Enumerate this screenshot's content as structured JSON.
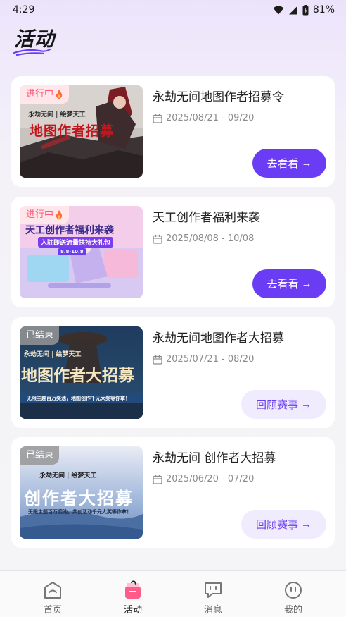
{
  "status_bar": {
    "time": "4:29",
    "battery": "81%"
  },
  "header": {
    "title": "活动"
  },
  "colors": {
    "accent": "#6a3cf3",
    "active_tag": "#ff5674",
    "ended_tag": "#969696"
  },
  "activities": [
    {
      "status": "进行中",
      "title": "永劫无间地图作者招募令",
      "date_range": "2025/08/21 - 09/20",
      "button_label": "去看看",
      "banner": {
        "logo": "永劫无间 | 绘梦天工",
        "headline": "地图作者招募"
      }
    },
    {
      "status": "进行中",
      "title": "天工创作者福利来袭",
      "date_range": "2025/08/08 - 10/08",
      "button_label": "去看看",
      "banner": {
        "headline": "天工创作者福利来袭",
        "sub": "入驻即送流量扶持大礼包",
        "dates": "8.8-10.8"
      }
    },
    {
      "status": "已结束",
      "title": "永劫无间地图作者大招募",
      "date_range": "2025/07/21 - 08/20",
      "button_label": "回顾赛事",
      "banner": {
        "logo": "永劫无间 | 绘梦天工",
        "headline": "地图作者大招募",
        "sub": "无限主题百万奖池，地图创作千元大奖等你拿！"
      }
    },
    {
      "status": "已结束",
      "title": "永劫无间 创作者大招募",
      "date_range": "2025/06/20 - 07/20",
      "button_label": "回顾赛事",
      "banner": {
        "logo": "永劫无间 | 绘梦天工",
        "headline": "创作者大招募",
        "sub": "无限主题百万奖池，共创活动千元大奖等你拿！"
      }
    }
  ],
  "tab_bar": [
    {
      "label": "首页",
      "icon": "home-icon",
      "active": false
    },
    {
      "label": "活动",
      "icon": "activity-icon",
      "active": true
    },
    {
      "label": "消息",
      "icon": "message-icon",
      "active": false
    },
    {
      "label": "我的",
      "icon": "profile-icon",
      "active": false
    }
  ]
}
